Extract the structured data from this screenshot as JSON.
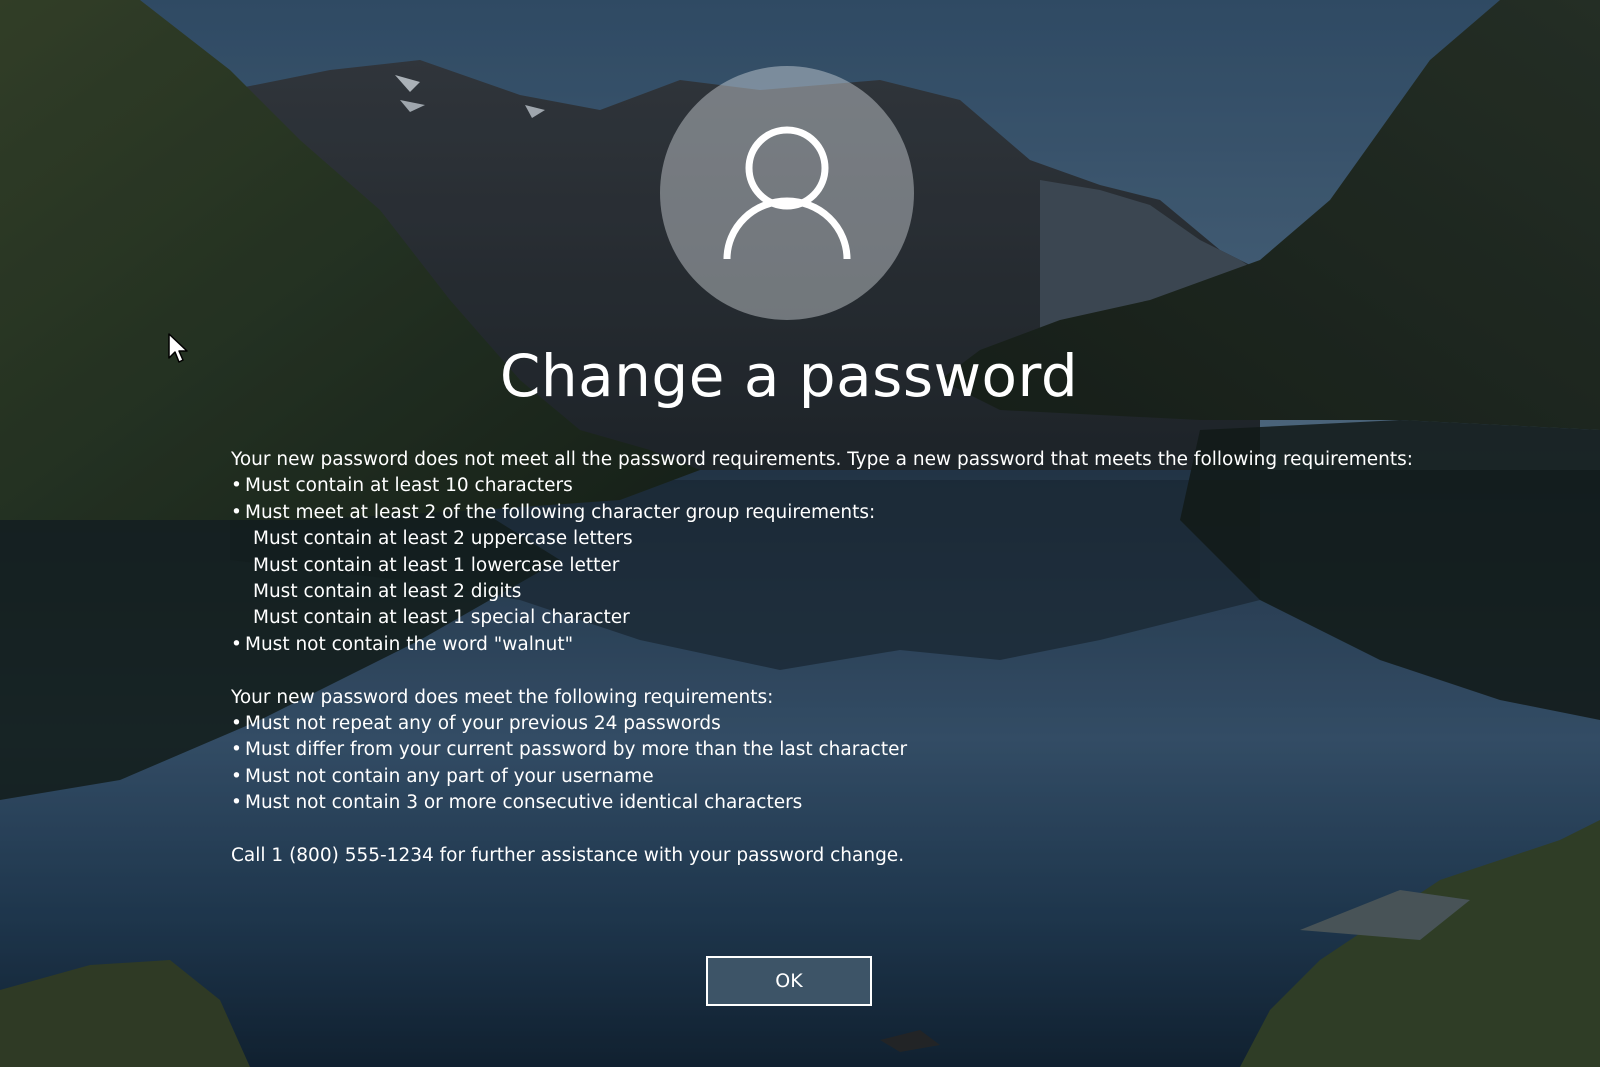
{
  "title": "Change a password",
  "avatar_icon": "user-icon",
  "message": {
    "intro": "Your new password does not meet all the password requirements. Type a new password that meets the following requirements:",
    "unmet": [
      "Must contain at least 10 characters",
      "Must meet at least 2 of the following character group requirements:"
    ],
    "groups": [
      "Must contain at least 2 uppercase letters",
      "Must contain at least 1 lowercase letter",
      "Must contain at least 2 digits",
      "Must contain at least 1 special character"
    ],
    "unmet_last": "Must not contain the word \"walnut\"",
    "met_intro": "Your new password does meet the following requirements:",
    "met": [
      "Must not repeat any of your previous 24 passwords",
      "Must differ from your current password by more than the last character",
      "Must not contain any part of your username",
      "Must not contain 3 or more consecutive identical characters"
    ],
    "help": "Call 1 (800) 555-1234 for further assistance with your password change."
  },
  "bullet_char": "•",
  "ok_label": "OK",
  "colors": {
    "text": "#ffffff",
    "button_bg": "#3d5467",
    "button_border": "#ffffff",
    "avatar_bg": "#dee2e6"
  }
}
